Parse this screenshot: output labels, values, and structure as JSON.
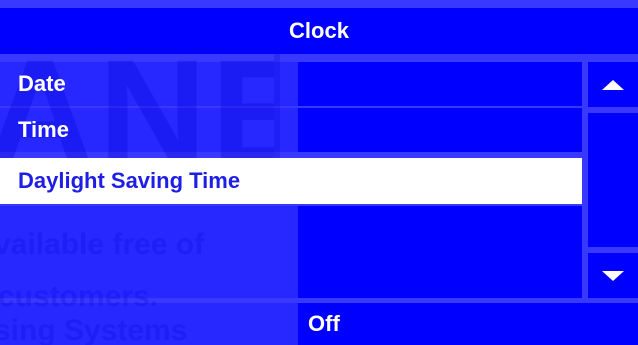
{
  "header": {
    "title": "Clock"
  },
  "menu": {
    "items": [
      {
        "label": "Date"
      },
      {
        "label": "Time"
      },
      {
        "label": "Daylight Saving Time",
        "selected": true
      },
      {
        "label": ""
      }
    ]
  },
  "scrollbar": {
    "up_icon": "triangle-up-icon",
    "down_icon": "triangle-down-icon"
  },
  "footer": {
    "value": "Off"
  },
  "watermark": {
    "logo_text": "ANE",
    "lines": [
      "vailable free of",
      "customers.",
      "sing Systems"
    ]
  },
  "colors": {
    "primary": "#0000ff",
    "text": "#ffffff",
    "selected_bg": "#ffffff",
    "selected_text": "#1e1ee6"
  }
}
